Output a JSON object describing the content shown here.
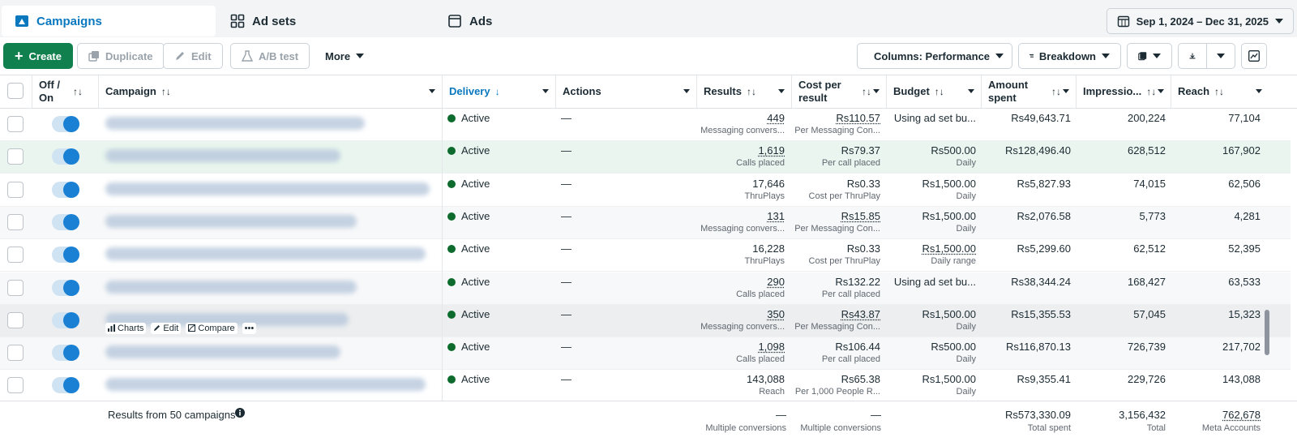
{
  "tabs": [
    {
      "label": "Campaigns",
      "icon": "campaign-icon",
      "active": true
    },
    {
      "label": "Ad sets",
      "icon": "grid-icon",
      "active": false
    },
    {
      "label": "Ads",
      "icon": "ad-page-icon",
      "active": false
    }
  ],
  "date_range": "Sep 1, 2024 – Dec 31, 2025",
  "toolbar": {
    "create": "Create",
    "duplicate": "Duplicate",
    "edit": "Edit",
    "ab_test": "A/B test",
    "more": "More",
    "columns": "Columns: Performance",
    "breakdown": "Breakdown"
  },
  "columns": {
    "off_on": "Off / On",
    "campaign": "Campaign",
    "delivery": "Delivery",
    "actions": "Actions",
    "results": "Results",
    "cost_per_result": "Cost per result",
    "budget": "Budget",
    "amount_spent": "Amount spent",
    "impressions": "Impressio...",
    "reach": "Reach"
  },
  "rows": [
    {
      "delivery": "Active",
      "actions": "—",
      "results": "449",
      "results_sub": "Messaging convers...",
      "cost": "Rs110.57",
      "cost_sub": "Per Messaging Con...",
      "budget": "Using ad set bu...",
      "budget_sub": "",
      "spent": "Rs49,643.71",
      "impressions": "200,224",
      "reach": "77,104"
    },
    {
      "delivery": "Active",
      "actions": "—",
      "results": "1,619",
      "results_sub": "Calls placed",
      "cost": "Rs79.37",
      "cost_sub": "Per call placed",
      "budget": "Rs500.00",
      "budget_sub": "Daily",
      "spent": "Rs128,496.40",
      "impressions": "628,512",
      "reach": "167,902"
    },
    {
      "delivery": "Active",
      "actions": "—",
      "results": "17,646",
      "results_sub": "ThruPlays",
      "cost": "Rs0.33",
      "cost_sub": "Cost per ThruPlay",
      "budget": "Rs1,500.00",
      "budget_sub": "Daily",
      "spent": "Rs5,827.93",
      "impressions": "74,015",
      "reach": "62,506"
    },
    {
      "delivery": "Active",
      "actions": "—",
      "results": "131",
      "results_sub": "Messaging convers...",
      "cost": "Rs15.85",
      "cost_sub": "Per Messaging Con...",
      "budget": "Rs1,500.00",
      "budget_sub": "Daily",
      "spent": "Rs2,076.58",
      "impressions": "5,773",
      "reach": "4,281"
    },
    {
      "delivery": "Active",
      "actions": "—",
      "results": "16,228",
      "results_sub": "ThruPlays",
      "cost": "Rs0.33",
      "cost_sub": "Cost per ThruPlay",
      "budget": "Rs1,500.00",
      "budget_sub": "Daily range",
      "spent": "Rs5,299.60",
      "impressions": "62,512",
      "reach": "52,395"
    },
    {
      "delivery": "Active",
      "actions": "—",
      "results": "290",
      "results_sub": "Calls placed",
      "cost": "Rs132.22",
      "cost_sub": "Per call placed",
      "budget": "Using ad set bu...",
      "budget_sub": "",
      "spent": "Rs38,344.24",
      "impressions": "168,427",
      "reach": "63,533"
    },
    {
      "delivery": "Active",
      "actions": "—",
      "results": "350",
      "results_sub": "Messaging convers...",
      "cost": "Rs43.87",
      "cost_sub": "Per Messaging Con...",
      "budget": "Rs1,500.00",
      "budget_sub": "Daily",
      "spent": "Rs15,355.53",
      "impressions": "57,045",
      "reach": "15,323"
    },
    {
      "delivery": "Active",
      "actions": "—",
      "results": "1,098",
      "results_sub": "Calls placed",
      "cost": "Rs106.44",
      "cost_sub": "Per call placed",
      "budget": "Rs500.00",
      "budget_sub": "Daily",
      "spent": "Rs116,870.13",
      "impressions": "726,739",
      "reach": "217,702"
    },
    {
      "delivery": "Active",
      "actions": "—",
      "results": "143,088",
      "results_sub": "Reach",
      "cost": "Rs65.38",
      "cost_sub": "Per 1,000 People R...",
      "budget": "Rs1,500.00",
      "budget_sub": "Daily",
      "spent": "Rs9,355.41",
      "impressions": "229,726",
      "reach": "143,088"
    }
  ],
  "row_hover_actions": {
    "charts": "Charts",
    "edit": "Edit",
    "compare": "Compare",
    "more": "•••"
  },
  "footer": {
    "label": "Results from 50 campaigns",
    "results": "—",
    "results_sub": "Multiple conversions",
    "cost": "—",
    "cost_sub": "Multiple conversions",
    "spent": "Rs573,330.09",
    "spent_sub": "Total spent",
    "impressions": "3,156,432",
    "impressions_sub": "Total",
    "reach": "762,678",
    "reach_sub": "Meta Accounts"
  },
  "colors": {
    "accent": "#0a78be",
    "create": "#11804f",
    "active_dot": "#0d6b2e",
    "toggle": "#1a80d4"
  }
}
